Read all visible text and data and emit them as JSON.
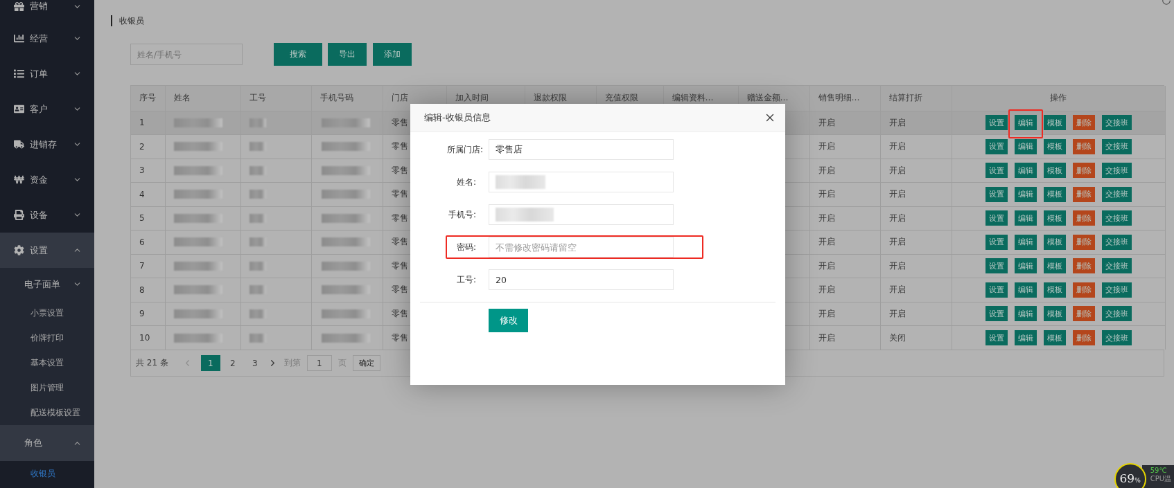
{
  "sidebar": {
    "items": [
      {
        "label": "营销",
        "expanded": false
      },
      {
        "label": "经营",
        "expanded": false
      },
      {
        "label": "订单",
        "expanded": false
      },
      {
        "label": "客户",
        "expanded": false
      },
      {
        "label": "进销存",
        "expanded": false
      },
      {
        "label": "资金",
        "expanded": false
      },
      {
        "label": "设备",
        "expanded": false
      },
      {
        "label": "设置",
        "expanded": true,
        "children": [
          {
            "label": "电子面单",
            "kind": "group",
            "expanded": false
          },
          {
            "label": "小票设置",
            "kind": "link",
            "selected": false
          },
          {
            "label": "价牌打印",
            "kind": "link",
            "selected": false
          },
          {
            "label": "基本设置",
            "kind": "link",
            "selected": false
          },
          {
            "label": "图片管理",
            "kind": "link",
            "selected": false
          },
          {
            "label": "配送模板设置",
            "kind": "link",
            "selected": false
          },
          {
            "label": "角色",
            "kind": "group",
            "expanded": true,
            "children": [
              {
                "label": "收银员",
                "kind": "link",
                "selected": true
              }
            ]
          }
        ]
      }
    ]
  },
  "breadcrumb": {
    "title": "收银员"
  },
  "toolbar": {
    "search": {
      "placeholder": "姓名/手机号"
    },
    "buttons": [
      "搜索",
      "导出",
      "添加"
    ]
  },
  "table": {
    "columns": [
      "序号",
      "姓名",
      "工号",
      "手机号码",
      "门店",
      "加入时间",
      "退款权限",
      "充值权限",
      "编辑资料…",
      "赠送金额…",
      "销售明细…",
      "结算打折",
      "操作"
    ],
    "rows": [
      {
        "no": "1",
        "store": "零售",
        "sales_detail": "开启",
        "settlement": "开启",
        "hovered": true,
        "actions": [
          {
            "label": "设置",
            "kind": "normal",
            "highlighted": false
          },
          {
            "label": "编辑",
            "kind": "normal",
            "highlighted": true
          },
          {
            "label": "模板",
            "kind": "normal",
            "highlighted": false
          },
          {
            "label": "删除",
            "kind": "danger",
            "highlighted": false
          },
          {
            "label": "交接班",
            "kind": "normal",
            "highlighted": false
          }
        ]
      },
      {
        "no": "2",
        "store": "零售",
        "sales_detail": "开启",
        "settlement": "开启",
        "hovered": false,
        "actions": [
          {
            "label": "设置",
            "kind": "normal",
            "highlighted": false
          },
          {
            "label": "编辑",
            "kind": "normal",
            "highlighted": false
          },
          {
            "label": "模板",
            "kind": "normal",
            "highlighted": false
          },
          {
            "label": "删除",
            "kind": "danger",
            "highlighted": false
          },
          {
            "label": "交接班",
            "kind": "normal",
            "highlighted": false
          }
        ]
      },
      {
        "no": "3",
        "store": "零售",
        "sales_detail": "开启",
        "settlement": "开启",
        "hovered": false,
        "actions": [
          {
            "label": "设置",
            "kind": "normal",
            "highlighted": false
          },
          {
            "label": "编辑",
            "kind": "normal",
            "highlighted": false
          },
          {
            "label": "模板",
            "kind": "normal",
            "highlighted": false
          },
          {
            "label": "删除",
            "kind": "danger",
            "highlighted": false
          },
          {
            "label": "交接班",
            "kind": "normal",
            "highlighted": false
          }
        ]
      },
      {
        "no": "4",
        "store": "零售",
        "sales_detail": "开启",
        "settlement": "开启",
        "hovered": false,
        "actions": [
          {
            "label": "设置",
            "kind": "normal",
            "highlighted": false
          },
          {
            "label": "编辑",
            "kind": "normal",
            "highlighted": false
          },
          {
            "label": "模板",
            "kind": "normal",
            "highlighted": false
          },
          {
            "label": "删除",
            "kind": "danger",
            "highlighted": false
          },
          {
            "label": "交接班",
            "kind": "normal",
            "highlighted": false
          }
        ]
      },
      {
        "no": "5",
        "store": "零售",
        "sales_detail": "开启",
        "settlement": "开启",
        "hovered": false,
        "actions": [
          {
            "label": "设置",
            "kind": "normal",
            "highlighted": false
          },
          {
            "label": "编辑",
            "kind": "normal",
            "highlighted": false
          },
          {
            "label": "模板",
            "kind": "normal",
            "highlighted": false
          },
          {
            "label": "删除",
            "kind": "danger",
            "highlighted": false
          },
          {
            "label": "交接班",
            "kind": "normal",
            "highlighted": false
          }
        ]
      },
      {
        "no": "6",
        "store": "零售",
        "sales_detail": "开启",
        "settlement": "开启",
        "hovered": false,
        "actions": [
          {
            "label": "设置",
            "kind": "normal",
            "highlighted": false
          },
          {
            "label": "编辑",
            "kind": "normal",
            "highlighted": false
          },
          {
            "label": "模板",
            "kind": "normal",
            "highlighted": false
          },
          {
            "label": "删除",
            "kind": "danger",
            "highlighted": false
          },
          {
            "label": "交接班",
            "kind": "normal",
            "highlighted": false
          }
        ]
      },
      {
        "no": "7",
        "store": "零售",
        "sales_detail": "开启",
        "settlement": "开启",
        "hovered": false,
        "actions": [
          {
            "label": "设置",
            "kind": "normal",
            "highlighted": false
          },
          {
            "label": "编辑",
            "kind": "normal",
            "highlighted": false
          },
          {
            "label": "模板",
            "kind": "normal",
            "highlighted": false
          },
          {
            "label": "删除",
            "kind": "danger",
            "highlighted": false
          },
          {
            "label": "交接班",
            "kind": "normal",
            "highlighted": false
          }
        ]
      },
      {
        "no": "8",
        "store": "零售",
        "sales_detail": "开启",
        "settlement": "开启",
        "hovered": false,
        "actions": [
          {
            "label": "设置",
            "kind": "normal",
            "highlighted": false
          },
          {
            "label": "编辑",
            "kind": "normal",
            "highlighted": false
          },
          {
            "label": "模板",
            "kind": "normal",
            "highlighted": false
          },
          {
            "label": "删除",
            "kind": "danger",
            "highlighted": false
          },
          {
            "label": "交接班",
            "kind": "normal",
            "highlighted": false
          }
        ]
      },
      {
        "no": "9",
        "store": "零售",
        "sales_detail": "开启",
        "settlement": "开启",
        "hovered": false,
        "actions": [
          {
            "label": "设置",
            "kind": "normal",
            "highlighted": false
          },
          {
            "label": "编辑",
            "kind": "normal",
            "highlighted": false
          },
          {
            "label": "模板",
            "kind": "normal",
            "highlighted": false
          },
          {
            "label": "删除",
            "kind": "danger",
            "highlighted": false
          },
          {
            "label": "交接班",
            "kind": "normal",
            "highlighted": false
          }
        ]
      },
      {
        "no": "10",
        "store": "零售",
        "sales_detail": "开启",
        "settlement": "关闭",
        "hovered": false,
        "actions": [
          {
            "label": "设置",
            "kind": "normal",
            "highlighted": false
          },
          {
            "label": "编辑",
            "kind": "normal",
            "highlighted": false
          },
          {
            "label": "模板",
            "kind": "normal",
            "highlighted": false
          },
          {
            "label": "删除",
            "kind": "danger",
            "highlighted": false
          },
          {
            "label": "交接班",
            "kind": "normal",
            "highlighted": false
          }
        ]
      }
    ]
  },
  "pagination": {
    "total": "共 21 条",
    "prev_disabled": true,
    "next_disabled": false,
    "pages": [
      {
        "label": "1",
        "selected": true
      },
      {
        "label": "2",
        "selected": false
      },
      {
        "label": "3",
        "selected": false
      }
    ],
    "goto_label": "到第",
    "goto_value": "1",
    "page_suffix": "页",
    "confirm": "确定"
  },
  "dialog": {
    "title": "编辑-收银员信息",
    "fields": [
      {
        "label": "所属门店:",
        "kind": "text",
        "value": "零售店",
        "highlighted": false
      },
      {
        "label": "姓名:",
        "kind": "redacted",
        "highlighted": false
      },
      {
        "label": "手机号:",
        "kind": "redacted",
        "highlighted": false
      },
      {
        "label": "密码:",
        "kind": "text",
        "placeholder": "不需修改密码请留空",
        "highlighted": true
      },
      {
        "label": "工号:",
        "kind": "text",
        "value": "20",
        "highlighted": false
      }
    ],
    "submit": "修改"
  },
  "cpu_widget": {
    "usage": "69",
    "unit": "%",
    "temperature": "59℃",
    "label": "CPU温"
  }
}
